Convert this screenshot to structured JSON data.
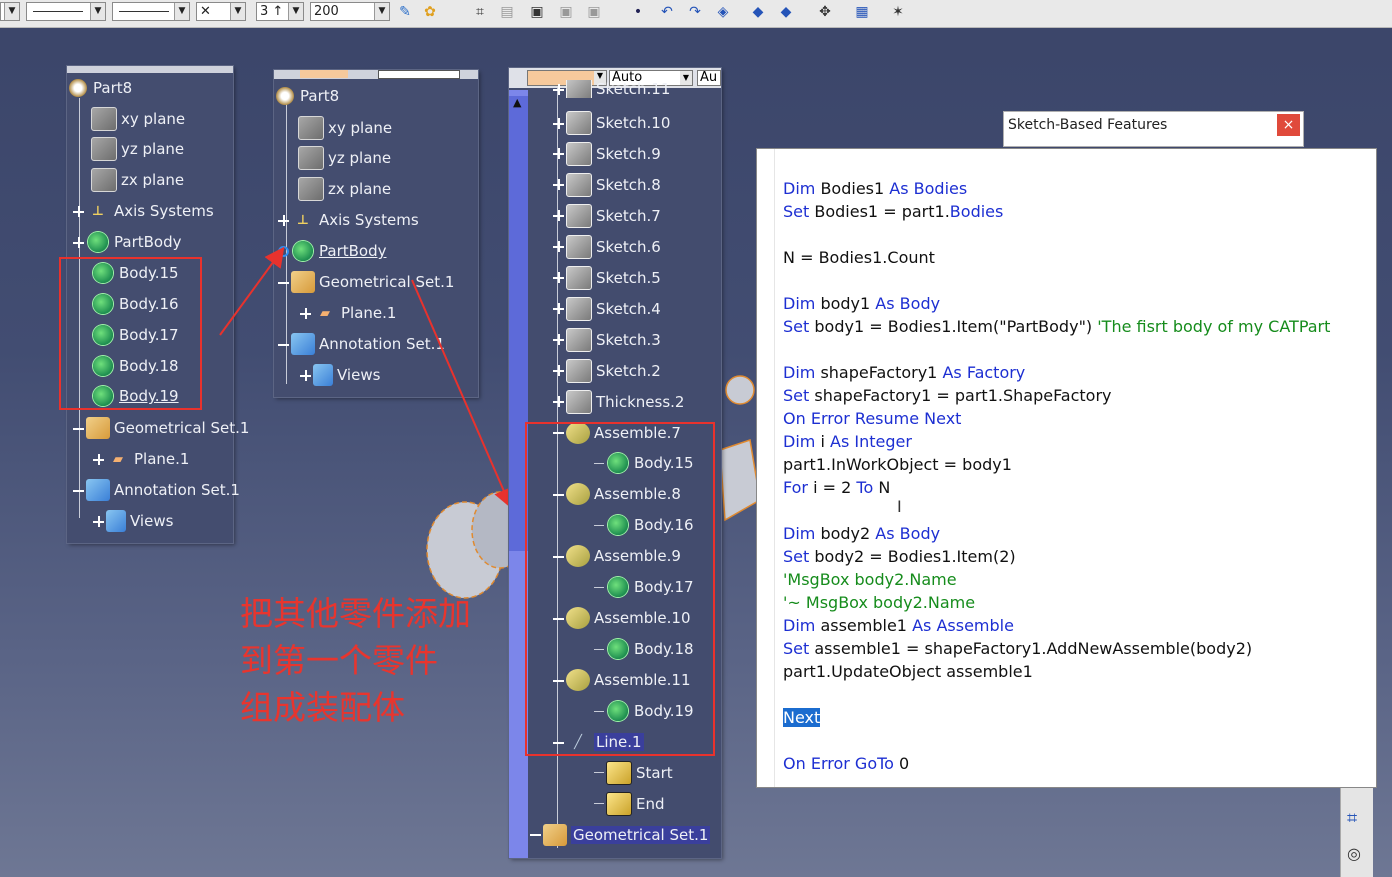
{
  "toolbar": {
    "combo1": "",
    "combo2": "",
    "combo3": "",
    "combo4": "",
    "combo5": "3",
    "combo6": "200",
    "icons": [
      "pencil-brush-icon",
      "paint-icon",
      "grid-icon",
      "sheet-icon",
      "image-icon",
      "image-icon",
      "image-icon",
      "point-icon",
      "undo-icon",
      "redo-icon",
      "eraser-icon",
      "view-icon",
      "view-icon",
      "pan-icon",
      "chart-icon",
      "tool-icon"
    ]
  },
  "tree1": {
    "root": "Part8",
    "items": [
      "xy plane",
      "yz plane",
      "zx plane",
      "Axis Systems",
      "PartBody",
      "Body.15",
      "Body.16",
      "Body.17",
      "Body.18",
      "Body.19",
      "Geometrical Set.1",
      "Plane.1",
      "Annotation Set.1",
      "Views"
    ]
  },
  "tree2": {
    "combo": "",
    "root": "Part8",
    "items": [
      "xy plane",
      "yz plane",
      "zx plane",
      "Axis Systems",
      "PartBody",
      "Geometrical Set.1",
      "Plane.1",
      "Annotation Set.1",
      "Views"
    ]
  },
  "tree3": {
    "combo_auto": "Auto",
    "combo_au": "Au",
    "top_partial": "Sketch.11",
    "items": [
      "Sketch.10",
      "Sketch.9",
      "Sketch.8",
      "Sketch.7",
      "Sketch.6",
      "Sketch.5",
      "Sketch.4",
      "Sketch.3",
      "Sketch.2",
      "Thickness.2",
      "Assemble.7",
      "Body.15",
      "Assemble.8",
      "Body.16",
      "Assemble.9",
      "Body.17",
      "Assemble.10",
      "Body.18",
      "Assemble.11",
      "Body.19",
      "Line.1",
      "Start",
      "End",
      "Geometrical Set.1"
    ]
  },
  "dialog": {
    "title": "Sketch-Based Features",
    "close": "×"
  },
  "code": {
    "lines": [
      "Dim Bodies1 As Bodies",
      "Set Bodies1 = part1.Bodies",
      "",
      "N = Bodies1.Count",
      "",
      "Dim body1 As Body",
      "Set body1 = Bodies1.Item(\"PartBody\") 'The fisrt body of my CATPart",
      "",
      "Dim shapeFactory1 As Factory",
      "Set shapeFactory1 = part1.ShapeFactory",
      "On Error Resume Next",
      "Dim i As Integer",
      "part1.InWorkObject = body1",
      "For i = 2 To N",
      "",
      "Dim body2 As Body",
      "Set body2 = Bodies1.Item(2)",
      "'MsgBox body2.Name",
      "'~ MsgBox body2.Name",
      "Dim assemble1 As Assemble",
      "Set assemble1 = shapeFactory1.AddNewAssemble(body2)",
      "part1.UpdateObject assemble1",
      "",
      "Next",
      "",
      "On Error GoTo 0"
    ]
  },
  "annotation": {
    "line1": "把其他零件添加",
    "line2": "到第一个零件",
    "line3": "组成装配体"
  },
  "colors": {
    "background": "#424d72",
    "tree_text": "#eef0f6",
    "highlight_red": "#e8322d",
    "keyword_blue": "#1d2fd2",
    "comment_green": "#168c1c"
  }
}
